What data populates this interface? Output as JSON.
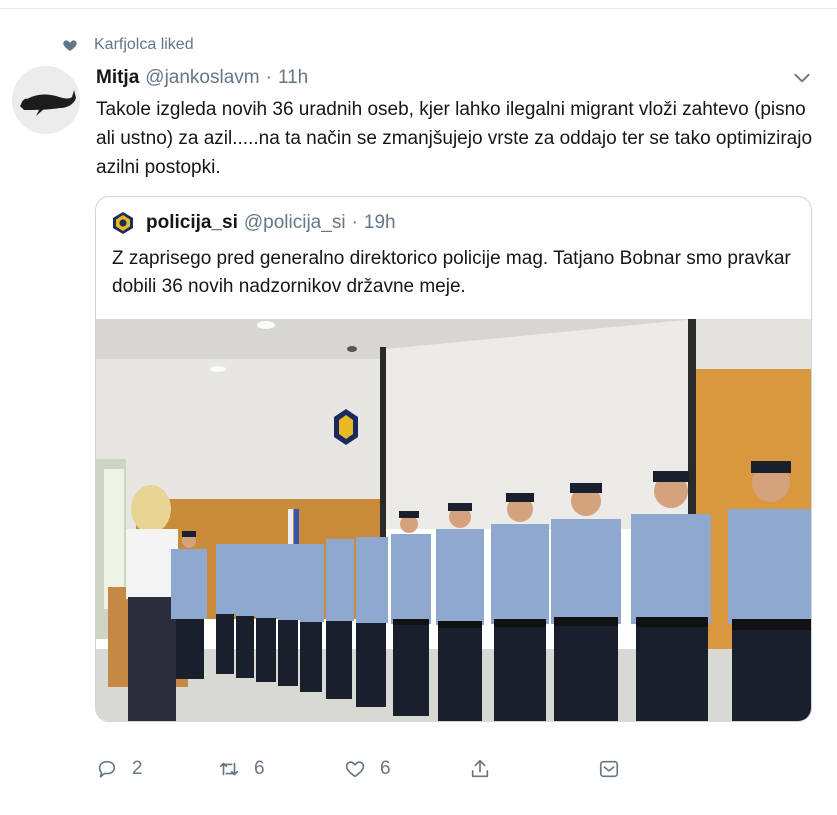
{
  "social_context": {
    "text": "Karfjolca liked"
  },
  "tweet": {
    "author_name": "Mitja",
    "handle": "@jankoslavm",
    "separator": "·",
    "time": "11h",
    "text": "Takole izgleda novih 36 uradnih oseb, kjer lahko ilegalni migrant vloži zahtevo (pisno ali ustno) za azil.....na ta način se zmanjšujejo vrste za oddajo ter se tako optimizirajo azilni postopki."
  },
  "quoted": {
    "author_name": "policija_si",
    "handle": "@policija_si",
    "separator": "·",
    "time": "19h",
    "text": "Z zaprisego pred generalno direktorico policije mag. Tatjano Bobnar smo pravkar dobili 36 novih nadzornikov državne meje."
  },
  "actions": {
    "replies": "2",
    "retweets": "6",
    "likes": "6"
  },
  "icons": [
    "heart-icon",
    "avatar-whale",
    "chevron-down-icon",
    "police-badge-icon",
    "reply-icon",
    "retweet-icon",
    "like-icon",
    "share-icon",
    "dm-icon"
  ],
  "colors": {
    "secondary_text": "#657786",
    "border": "#ccd6dd",
    "uniform_shirt": "#8fa8d0",
    "uniform_pants": "#1a1f2e"
  }
}
